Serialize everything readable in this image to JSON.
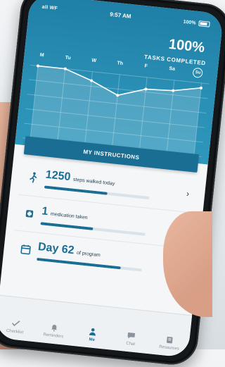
{
  "status_bar": {
    "carrier": "all WF",
    "time": "9:57 AM",
    "battery": "100%"
  },
  "header": {
    "percent": "100%",
    "label": "TASKS COMPLETED",
    "days": [
      "M",
      "Tu",
      "W",
      "Th",
      "F",
      "Sa",
      "Su"
    ],
    "today": "Su"
  },
  "chart_data": {
    "type": "line",
    "categories": [
      "M",
      "Tu",
      "W",
      "Th",
      "F",
      "Sa",
      "Su"
    ],
    "series": [
      {
        "values": [
          100,
          100,
          87,
          70,
          83,
          85,
          93
        ]
      }
    ],
    "ylim": [
      0,
      100
    ]
  },
  "instructions_button": "MY INSTRUCTIONS",
  "cards": [
    {
      "value": "1250",
      "text": "steps walked today",
      "progress": 0.6,
      "icon": "walking-icon"
    },
    {
      "value": "1",
      "text": "medication taken",
      "progress": 0.5,
      "icon": "pill-icon"
    },
    {
      "value": "Day 62",
      "text": "of program",
      "progress": 0.8,
      "icon": "calendar-icon"
    }
  ],
  "tabs": [
    {
      "label": "Checklist",
      "icon": "checklist-icon",
      "active": false
    },
    {
      "label": "Reminders",
      "icon": "bell-icon",
      "active": false
    },
    {
      "label": "Me",
      "icon": "person-icon",
      "active": true
    },
    {
      "label": "Chat",
      "icon": "chat-icon",
      "active": false
    },
    {
      "label": "Resources",
      "icon": "resources-icon",
      "active": false
    }
  ],
  "colors": {
    "header": "#2a8fb4",
    "accent": "#1b6e93",
    "bar_track": "#d9e3ea",
    "screen_bg": "#f4f6f8"
  }
}
